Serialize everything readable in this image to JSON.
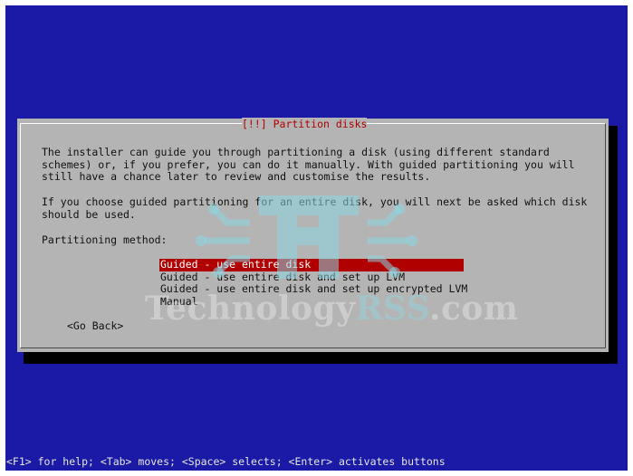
{
  "dialog": {
    "title": "[!!] Partition disks",
    "paragraph_1": "The installer can guide you through partitioning a disk (using different standard\nschemes) or, if you prefer, you can do it manually. With guided partitioning you will\nstill have a chance later to review and customise the results.",
    "paragraph_2": "If you choose guided partitioning for an entire disk, you will next be asked which disk\nshould be used.",
    "method_label": "Partitioning method:",
    "options": [
      {
        "label": "Guided - use entire disk",
        "selected": true
      },
      {
        "label": "Guided - use entire disk and set up LVM",
        "selected": false
      },
      {
        "label": "Guided - use entire disk and set up encrypted LVM",
        "selected": false
      },
      {
        "label": "Manual",
        "selected": false
      }
    ],
    "go_back_label": "<Go Back>"
  },
  "watermark": {
    "text_main": "TechnologyRSS.com",
    "text_part1": "Technology",
    "text_part2": "RSS",
    "text_part3": ".com"
  },
  "status_bar": {
    "text": "<F1> for help; <Tab> moves; <Space> selects; <Enter> activates buttons"
  },
  "colors": {
    "screen_bg": "#1a1aa6",
    "dialog_bg": "#b4b4b4",
    "selection": "#b00000",
    "title": "#b00000"
  }
}
